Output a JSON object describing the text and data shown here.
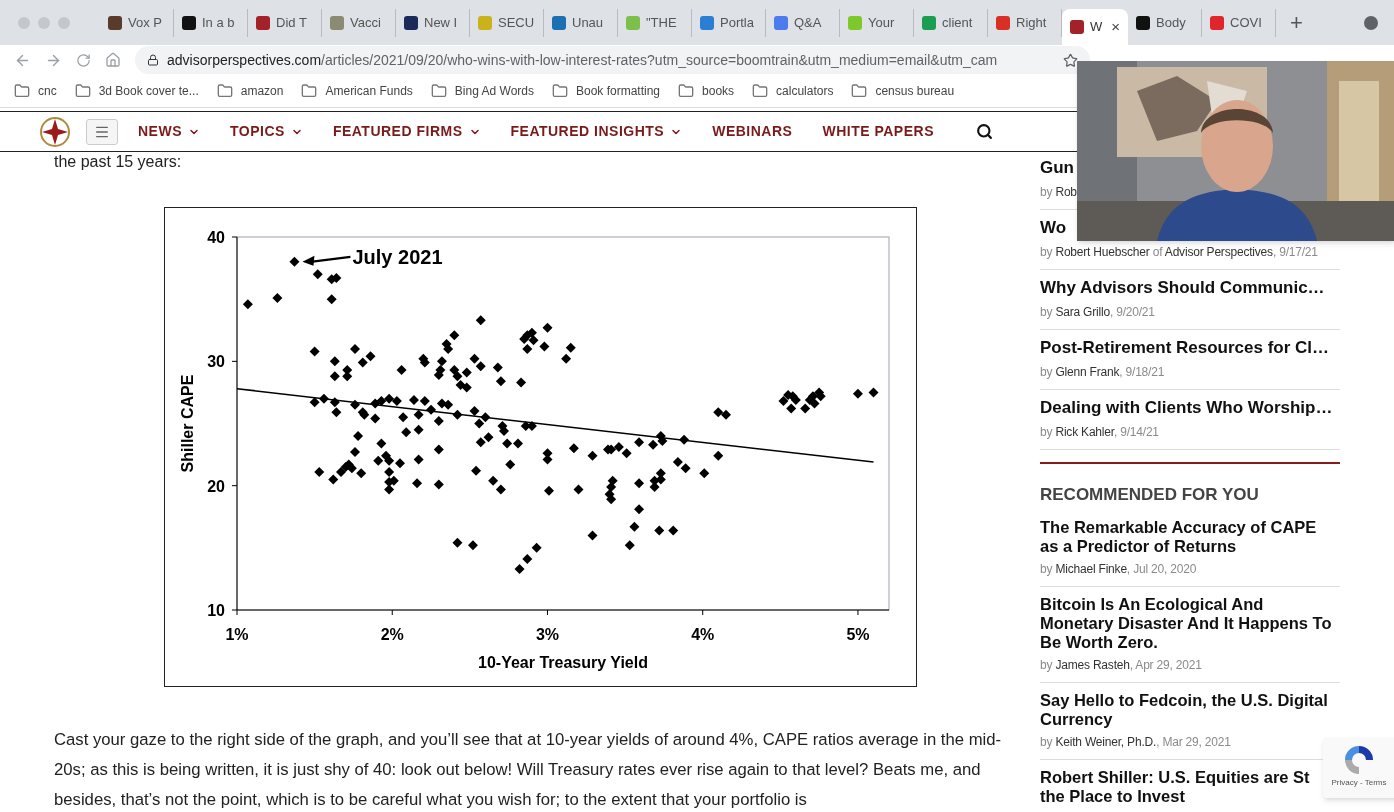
{
  "tabs": [
    {
      "label": "Vox P",
      "color": "#5a3b2a",
      "selected": false
    },
    {
      "label": "In a b",
      "color": "#111111",
      "selected": false
    },
    {
      "label": "Did T",
      "color": "#a3222a",
      "selected": false
    },
    {
      "label": "Vacci",
      "color": "#8c8a70",
      "selected": false
    },
    {
      "label": "New I",
      "color": "#1c2a5a",
      "selected": false
    },
    {
      "label": "SECU",
      "color": "#c9b21a",
      "selected": false
    },
    {
      "label": "Unau",
      "color": "#1c6fb0",
      "selected": false
    },
    {
      "label": "\"THE",
      "color": "#7cc04a",
      "selected": false
    },
    {
      "label": "Portla",
      "color": "#2a7fd4",
      "selected": false
    },
    {
      "label": "Q&A",
      "color": "#4b7bec",
      "selected": false
    },
    {
      "label": "Your",
      "color": "#7dc82a",
      "selected": false
    },
    {
      "label": "client",
      "color": "#1a9e52",
      "selected": false
    },
    {
      "label": "Right",
      "color": "#d93025",
      "selected": false
    },
    {
      "label": "W",
      "color": "#a3222a",
      "selected": true,
      "close": "×"
    },
    {
      "label": "Body",
      "color": "#111111",
      "selected": false
    },
    {
      "label": "COVI",
      "color": "#e0262b",
      "selected": false
    }
  ],
  "new_tab": "+",
  "address": {
    "domain": "advisorperspectives.com",
    "path": "/articles/2021/09/20/who-wins-with-low-interest-rates?utm_source=boomtrain&utm_medium=email&utm_cam"
  },
  "bookmarks": [
    "cnc",
    "3d Book cover te...",
    "amazon",
    "American Funds",
    "Bing Ad Words",
    "Book formatting",
    "books",
    "calculators",
    "census bureau"
  ],
  "nav": [
    {
      "label": "NEWS",
      "dropdown": true
    },
    {
      "label": "TOPICS",
      "dropdown": true
    },
    {
      "label": "FEATURED FIRMS",
      "dropdown": true
    },
    {
      "label": "FEATURED INSIGHTS",
      "dropdown": true
    },
    {
      "label": "WEBINARS",
      "dropdown": false
    },
    {
      "label": "WHITE PAPERS",
      "dropdown": false
    }
  ],
  "article": {
    "lead": "the past 15 years:",
    "chart_data": {
      "type": "scatter",
      "xlabel": "10-Year Treasury Yield",
      "ylabel": "Shiller CAPE",
      "xlim": [
        1,
        5.2
      ],
      "ylim": [
        10,
        40
      ],
      "xticks": [
        {
          "value": 1,
          "label": "1%"
        },
        {
          "value": 2,
          "label": "2%"
        },
        {
          "value": 3,
          "label": "3%"
        },
        {
          "value": 4,
          "label": "4%"
        },
        {
          "value": 5,
          "label": "5%"
        }
      ],
      "yticks": [
        10,
        20,
        30,
        40
      ],
      "x": [
        1.07,
        1.26,
        1.37,
        1.52,
        1.61,
        1.64,
        1.61,
        1.5,
        1.63,
        1.63,
        1.71,
        1.71,
        1.76,
        1.81,
        1.86,
        1.5,
        1.56,
        1.63,
        1.64,
        1.76,
        1.81,
        1.82,
        1.78,
        1.76,
        1.53,
        1.62,
        1.67,
        1.7,
        1.72,
        1.74,
        1.8,
        1.89,
        1.89,
        1.93,
        1.98,
        2.03,
        1.93,
        1.91,
        1.96,
        1.98,
        1.98,
        1.98,
        1.98,
        2.01,
        2.05,
        2.06,
        2.07,
        2.09,
        2.14,
        2.17,
        2.17,
        2.17,
        2.16,
        2.2,
        2.21,
        2.21,
        2.25,
        2.3,
        2.3,
        2.3,
        2.31,
        2.3,
        2.32,
        2.32,
        2.36,
        2.35,
        2.36,
        2.4,
        2.4,
        2.42,
        2.44,
        2.48,
        2.48,
        2.42,
        2.42,
        2.52,
        2.54,
        2.53,
        2.56,
        2.57,
        2.57,
        2.53,
        2.6,
        2.57,
        2.62,
        2.65,
        2.68,
        2.7,
        2.7,
        2.71,
        2.72,
        2.74,
        2.76,
        2.81,
        2.83,
        2.82,
        2.87,
        2.93,
        2.86,
        2.9,
        2.85,
        2.87,
        2.9,
        2.91,
        2.87,
        2.98,
        3.0,
        3.0,
        3.0,
        3.01,
        3.12,
        3.15,
        3.17,
        3.2,
        3.29,
        3.29,
        3.39,
        3.41,
        3.46,
        3.4,
        3.41,
        3.41,
        3.42,
        3.51,
        3.53,
        3.56,
        3.59,
        3.59,
        3.59,
        3.68,
        3.69,
        3.69,
        3.73,
        3.73,
        3.73,
        3.74,
        3.72,
        3.81,
        3.84,
        3.88,
        3.89,
        4.01,
        4.1,
        4.1,
        4.15,
        4.52,
        4.55,
        4.57,
        4.58,
        4.6,
        4.66,
        4.69,
        4.71,
        4.72,
        4.75,
        4.76,
        5.0,
        5.1
      ],
      "series": [
        {
          "color": "#000000",
          "values": [
            34.6,
            35.1,
            38.0,
            37.0,
            36.6,
            36.7,
            35.0,
            30.8,
            30.0,
            28.8,
            29.3,
            28.8,
            31.0,
            29.9,
            30.4,
            26.7,
            27.0,
            26.7,
            25.9,
            26.5,
            25.9,
            25.7,
            24.0,
            22.7,
            21.1,
            20.5,
            21.1,
            21.5,
            21.7,
            21.4,
            21.0,
            25.4,
            26.6,
            26.8,
            27.0,
            26.8,
            23.4,
            22.0,
            22.4,
            22.0,
            21.1,
            20.3,
            19.7,
            20.4,
            21.8,
            29.3,
            25.5,
            24.3,
            26.9,
            25.7,
            24.5,
            22.1,
            20.2,
            30.2,
            29.9,
            26.8,
            26.1,
            25.2,
            22.9,
            20.1,
            29.3,
            28.9,
            30.0,
            26.6,
            26.5,
            31.4,
            31.0,
            32.1,
            29.3,
            28.8,
            28.1,
            27.9,
            29.1,
            25.7,
            15.4,
            15.2,
            21.2,
            26.0,
            25.0,
            33.3,
            29.6,
            30.2,
            25.5,
            23.5,
            23.9,
            20.4,
            29.5,
            28.4,
            19.7,
            24.8,
            24.4,
            23.4,
            21.7,
            23.4,
            28.3,
            13.3,
            14.1,
            15.0,
            24.8,
            24.8,
            31.8,
            32.1,
            32.3,
            31.7,
            31.0,
            31.2,
            32.7,
            22.6,
            22.1,
            19.6,
            30.2,
            31.1,
            23.0,
            19.7,
            22.4,
            16.0,
            22.9,
            22.9,
            23.1,
            19.3,
            18.9,
            19.9,
            20.4,
            22.6,
            15.2,
            16.7,
            18.1,
            23.5,
            20.2,
            23.3,
            19.9,
            20.4,
            20.5,
            21.0,
            24.0,
            23.6,
            16.4,
            16.4,
            21.9,
            23.7,
            21.4,
            21.0,
            22.4,
            25.9,
            25.7,
            26.8,
            27.3,
            26.2,
            27.2,
            26.9,
            26.2,
            26.9,
            27.2,
            26.6,
            27.5,
            27.2,
            27.4,
            27.5
          ]
        },
        {
          "type": "line",
          "color": "#000000",
          "x": [
            1,
            5.1
          ],
          "values": [
            27.8,
            21.9
          ]
        }
      ],
      "annotations": [
        "July 2021"
      ]
    },
    "paragraph": "Cast your gaze to the right side of the graph, and you’ll see that at 10-year yields of around 4%, CAPE ratios average in the mid-20s; as this is being written, it is just shy of 40: look out below! Will Treasury rates ever rise again to that level? Beats me, and besides, that’s not the point, which is to be careful what you wish for; to the extent that your portfolio is"
  },
  "sidebar": {
    "latest": [
      {
        "title": "Gun",
        "byline": [
          {
            "text": "by",
            "dim": true
          },
          {
            "text": "Rob",
            "dim": false
          }
        ]
      },
      {
        "title": "Wo",
        "byline": [
          {
            "text": "by",
            "dim": true
          },
          {
            "text": "Robert Huebscher",
            "dim": false
          },
          {
            "text": "of",
            "dim": true
          },
          {
            "text": "Advisor Perspectives",
            "dim": false
          },
          {
            "text": ", 9/17/21",
            "dim": true
          }
        ]
      },
      {
        "title": "Why Advisors Should Communic…",
        "byline": [
          {
            "text": "by",
            "dim": true
          },
          {
            "text": "Sara Grillo",
            "dim": false
          },
          {
            "text": ", 9/20/21",
            "dim": true
          }
        ]
      },
      {
        "title": "Post-Retirement Resources for Cl…",
        "byline": [
          {
            "text": "by",
            "dim": true
          },
          {
            "text": "Glenn Frank",
            "dim": false
          },
          {
            "text": ", 9/18/21",
            "dim": true
          }
        ]
      },
      {
        "title": "Dealing with Clients Who Worship…",
        "byline": [
          {
            "text": "by",
            "dim": true
          },
          {
            "text": "Rick Kahler",
            "dim": false
          },
          {
            "text": ", 9/14/21",
            "dim": true
          }
        ]
      }
    ],
    "recommended_heading": "RECOMMENDED FOR YOU",
    "recommended": [
      {
        "title": "The Remarkable Accuracy of CAPE as a Predictor of Returns",
        "byline": [
          {
            "text": "by",
            "dim": true
          },
          {
            "text": "Michael Finke",
            "dim": false
          },
          {
            "text": ", Jul 20, 2020",
            "dim": true
          }
        ]
      },
      {
        "title": "Bitcoin Is An Ecological And Monetary Disaster And It Happens To Be Worth Zero.",
        "byline": [
          {
            "text": "by",
            "dim": true
          },
          {
            "text": "James Rasteh",
            "dim": false
          },
          {
            "text": ", Apr 29, 2021",
            "dim": true
          }
        ]
      },
      {
        "title": "Say Hello to Fedcoin, the U.S. Digital Currency",
        "byline": [
          {
            "text": "by",
            "dim": true
          },
          {
            "text": "Keith Weiner, Ph.D.",
            "dim": false
          },
          {
            "text": ", Mar 29, 2021",
            "dim": true
          }
        ]
      },
      {
        "title": "Robert Shiller: U.S. Equities are St the Place to Invest"
      }
    ]
  },
  "recaptcha": "Privacy - Terms"
}
